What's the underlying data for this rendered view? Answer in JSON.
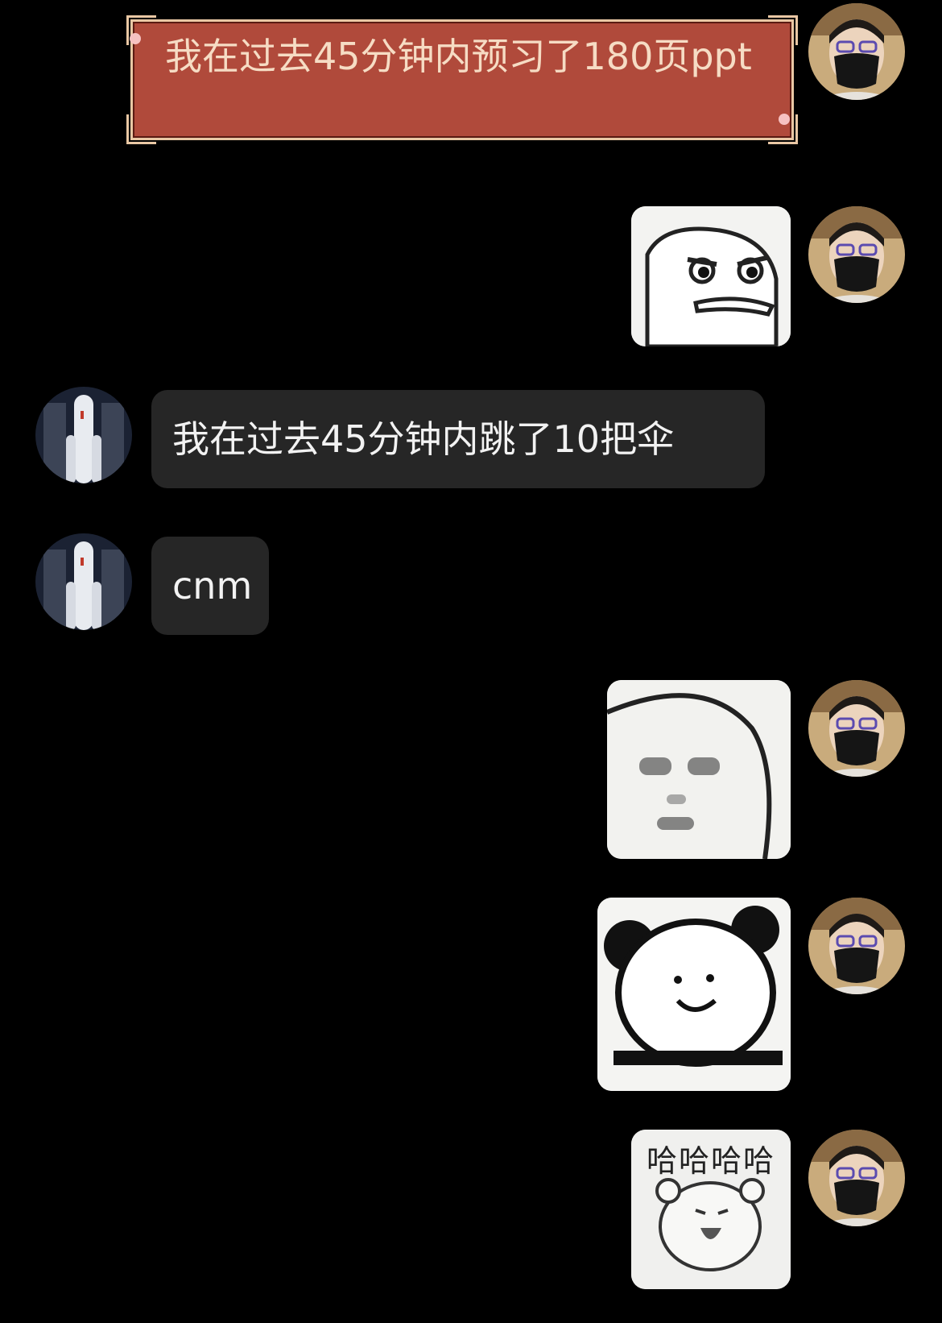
{
  "messages": [
    {
      "sender": "self",
      "type": "text",
      "style": "festive",
      "text": "我在过去45分钟内预习了180页ppt"
    },
    {
      "sender": "self",
      "type": "sticker",
      "sticker": "angry-bird-sticker"
    },
    {
      "sender": "other",
      "type": "text",
      "text": "我在过去45分钟内跳了10把伞"
    },
    {
      "sender": "other",
      "type": "text",
      "text": "cnm"
    },
    {
      "sender": "self",
      "type": "sticker",
      "sticker": "blurry-face-sticker"
    },
    {
      "sender": "self",
      "type": "sticker",
      "sticker": "panda-smile-sticker"
    },
    {
      "sender": "self",
      "type": "sticker",
      "sticker": "laughing-bear-sticker",
      "caption": "哈哈哈哈"
    }
  ],
  "colors": {
    "background": "#000000",
    "festive_bubble": "#b04a3b",
    "festive_border": "#e9c7a4",
    "dark_bubble": "#262626"
  }
}
